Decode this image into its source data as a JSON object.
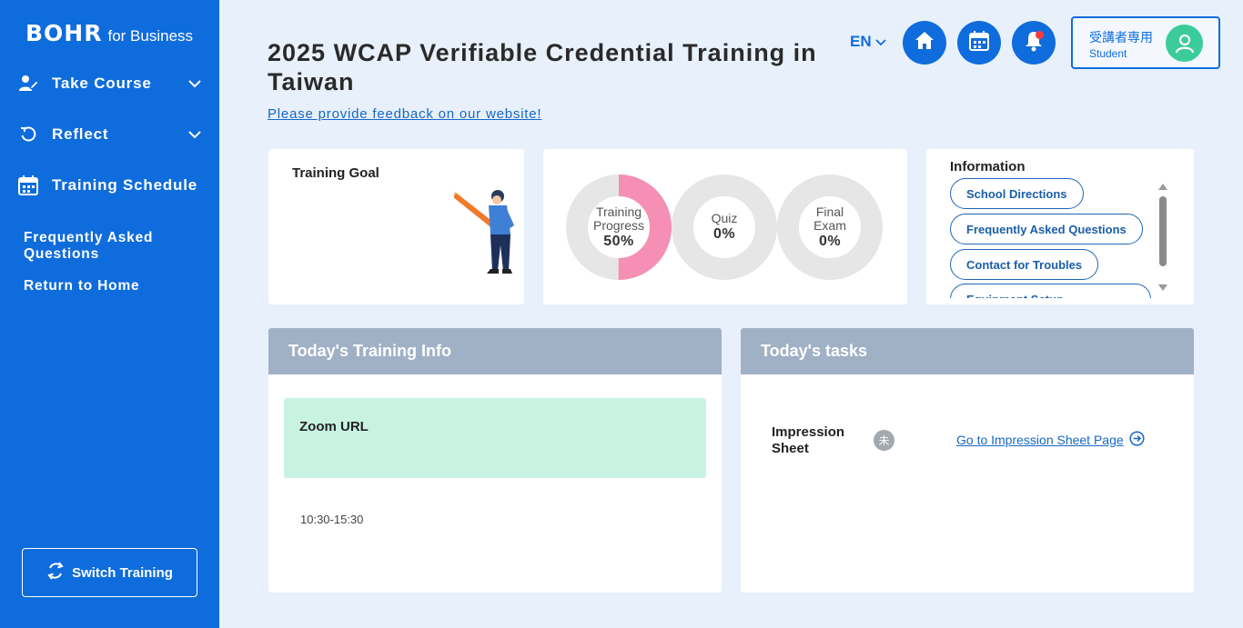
{
  "sidebar": {
    "logo_main": "BOHR",
    "logo_sub": "for Business",
    "items": [
      {
        "label": "Take Course"
      },
      {
        "label": "Reflect"
      },
      {
        "label": "Training Schedule"
      }
    ],
    "faq": "Frequently Asked Questions",
    "home": "Return to Home",
    "switch_label": "Switch Training"
  },
  "header": {
    "title": "2025 WCAP Verifiable Credential Training in Taiwan",
    "feedback": "Please provide feedback on our website!",
    "lang": "EN",
    "user_label_jp": "受講者専用",
    "user_role": "Student"
  },
  "goal": {
    "title": "Training Goal"
  },
  "progress": {
    "items": [
      {
        "label": "Training Progress",
        "value": "50%",
        "fraction": 0.5,
        "color": "#f58fb4"
      },
      {
        "label": "Quiz",
        "value": "0%",
        "fraction": 0,
        "color": "#f58fb4"
      },
      {
        "label": "Final Exam",
        "value": "0%",
        "fraction": 0,
        "color": "#f58fb4"
      }
    ],
    "track_color": "#e6e6e6"
  },
  "information": {
    "title": "Information",
    "links": [
      "School Directions",
      "Frequently Asked Questions",
      "Contact for Troubles",
      "Equipment Setup"
    ]
  },
  "training_info": {
    "header": "Today's Training Info",
    "zoom_label": "Zoom URL",
    "time": "10:30-15:30"
  },
  "tasks": {
    "header": "Today's tasks",
    "items": [
      {
        "name": "Impression Sheet",
        "badge": "未",
        "link": "Go to Impression Sheet Page"
      }
    ]
  },
  "icons": {
    "home": "home-icon",
    "calendar": "calendar-icon",
    "bell": "bell-icon",
    "user": "user-icon",
    "refresh": "refresh-icon",
    "arrow": "arrow-right-circle-icon"
  },
  "colors": {
    "primary": "#0f6cdc",
    "accent_pink": "#f58fb4",
    "mint": "#c8f3e3",
    "avatar_green": "#3ccc9b"
  }
}
